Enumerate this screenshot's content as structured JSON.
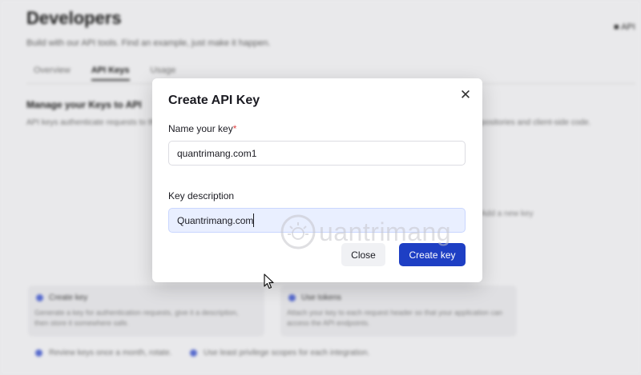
{
  "background": {
    "title": "Developers",
    "subtitle": "Build with our API tools. Find an example, just make it happen.",
    "top_right": "API",
    "tabs": [
      {
        "label": "Overview",
        "active": false
      },
      {
        "label": "API Keys",
        "active": true
      },
      {
        "label": "Usage",
        "active": false
      }
    ],
    "section_heading": "Manage your Keys to API",
    "section_desc": "API keys authenticate requests to the API. Keep your keys secure and do not share them in publicly accessible areas such as repositories and client-side code.",
    "side_text": "Add a new key",
    "cards": [
      {
        "title": "Create key",
        "desc": "Generate a key for authentication requests, give it a description, then store it somewhere safe."
      },
      {
        "title": "Use tokens",
        "desc": "Attach your key to each request header so that your application can access the API endpoints."
      }
    ],
    "checks": [
      "Review keys once a month, rotate.",
      "Use least privilege scopes for each integration."
    ]
  },
  "modal": {
    "title": "Create API Key",
    "close_icon": "close-icon",
    "name_label": "Name your key",
    "required_mark": "*",
    "name_value": "quantrimang.com1",
    "desc_label": "Key description",
    "desc_value": "Quantrimang.com",
    "close_button": "Close",
    "create_button": "Create key"
  },
  "watermark": {
    "text": "uantrimang",
    "icon": "sun-logo-icon"
  },
  "colors": {
    "primary": "#1e3fc4",
    "required": "#e04444",
    "input_focus_bg": "#e9efff"
  }
}
